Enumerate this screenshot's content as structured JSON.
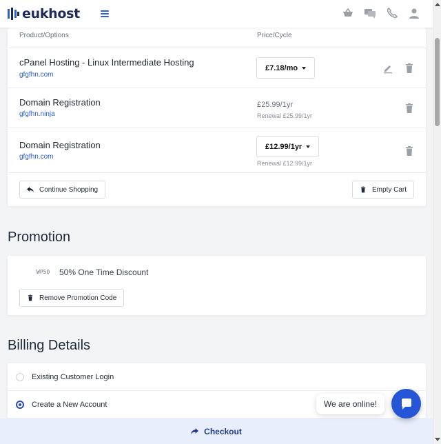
{
  "header": {
    "logo_text": "eukhost",
    "icons": [
      "basket-icon",
      "chat-icon",
      "phone-icon",
      "user-icon"
    ]
  },
  "cart": {
    "col_product": "Product/Options",
    "col_price": "Price/Cycle",
    "items": [
      {
        "name": "cPanel Hosting - Linux Intermediate Hosting",
        "domain": "gfgfhn.com",
        "price": "£7.18/mo",
        "renewal": ""
      },
      {
        "name": "Domain Registration",
        "domain": "gfgfhn.ninja",
        "price": "£25.99/1yr",
        "renewal": "Renewal £25.99/1yr"
      },
      {
        "name": "Domain Registration",
        "domain": "gfgfhn.com",
        "price": "£12.99/1yr",
        "renewal": "Renewal £12.99/1yr"
      }
    ],
    "continue_label": "Continue Shopping",
    "empty_label": "Empty Cart"
  },
  "promotion": {
    "title": "Promotion",
    "code": "WP50",
    "description": "50% One Time Discount",
    "remove_label": "Remove Promotion Code"
  },
  "billing": {
    "title": "Billing Details",
    "options": [
      {
        "label": "Existing Customer Login",
        "selected": false
      },
      {
        "label": "Create a New Account",
        "selected": true
      }
    ]
  },
  "chat": {
    "bubble_text": "We are online!"
  },
  "checkout": {
    "label": "Checkout"
  },
  "colors": {
    "accent": "#2456d6",
    "link": "#2b5fd9",
    "checkout_bg": "#e8eefb"
  }
}
